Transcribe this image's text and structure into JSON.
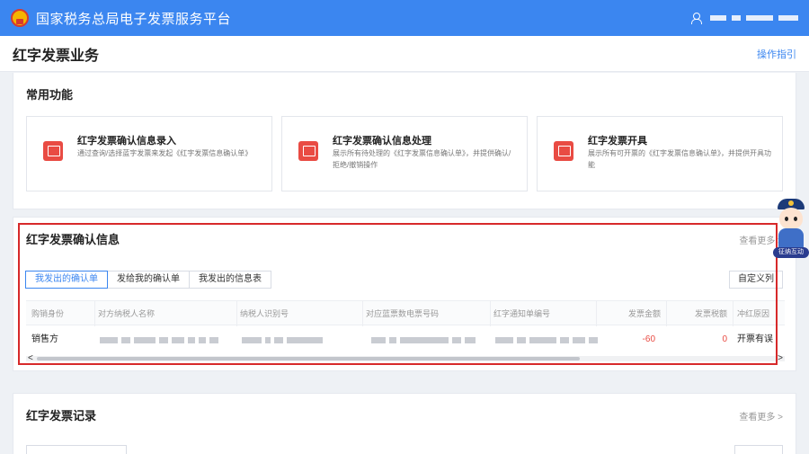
{
  "header": {
    "title": "国家税务总局电子发票服务平台"
  },
  "page": {
    "title": "红字发票业务",
    "guide_link": "操作指引"
  },
  "common": {
    "title": "常用功能",
    "items": [
      {
        "name": "红字发票确认信息录入",
        "desc": "通过查询/选择蓝字发票来发起《红字发票信息确认单》"
      },
      {
        "name": "红字发票确认信息处理",
        "desc": "展示所有待处理的《红字发票信息确认单》，并提供确认/拒绝/撤销操作"
      },
      {
        "name": "红字发票开具",
        "desc": "展示所有可开票的《红字发票信息确认单》，并提供开具功能"
      }
    ]
  },
  "confirm_info": {
    "title": "红字发票确认信息",
    "more": "查看更多 >",
    "tabs": [
      "我发出的确认单",
      "发给我的确认单",
      "我发出的信息表"
    ],
    "custom_columns": "自定义列",
    "columns": [
      "购销身份",
      "对方纳税人名称",
      "纳税人识别号",
      "对应蓝票数电票号码",
      "红字通知单编号",
      "发票金额",
      "发票税额",
      "冲红原因"
    ],
    "rows": [
      {
        "role": "销售方",
        "amount": "-60",
        "tax": "0",
        "reason": "开票有误"
      }
    ],
    "scroll_left": "<",
    "scroll_right": ">"
  },
  "records": {
    "title": "红字发票记录",
    "more": "查看更多 >"
  },
  "assistant": {
    "label": "征纳互动"
  },
  "colors": {
    "primary": "#3b86f0",
    "accent_red": "#e94b43",
    "highlight": "#d7292a"
  }
}
